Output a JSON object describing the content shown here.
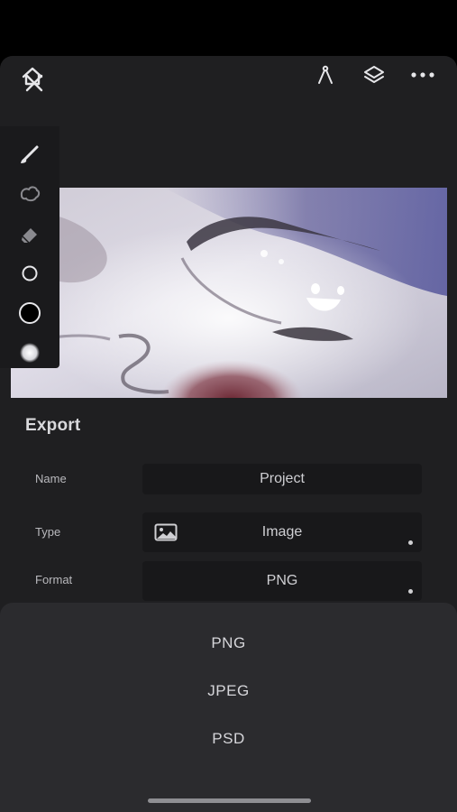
{
  "icons": {
    "home": "home-icon",
    "close": "close-icon",
    "compass": "compass-icon",
    "layers": "layers-icon",
    "more": "more-icon",
    "brush": "brush-icon",
    "smudge": "smudge-icon",
    "eraser": "eraser-icon",
    "brush_size": "brush-size-icon",
    "color": "color-icon",
    "opacity": "opacity-icon",
    "image": "image-icon"
  },
  "colors": {
    "sheet_bg": "#1f1f21",
    "field_bg": "#18181a",
    "picker_bg": "#2b2b2e",
    "text": "#d6d6da"
  },
  "export": {
    "title": "Export",
    "name_label": "Name",
    "name_value": "Project",
    "type_label": "Type",
    "type_value": "Image",
    "format_label": "Format",
    "format_value": "PNG"
  },
  "format_picker": {
    "options": [
      "PNG",
      "JPEG",
      "PSD"
    ]
  }
}
